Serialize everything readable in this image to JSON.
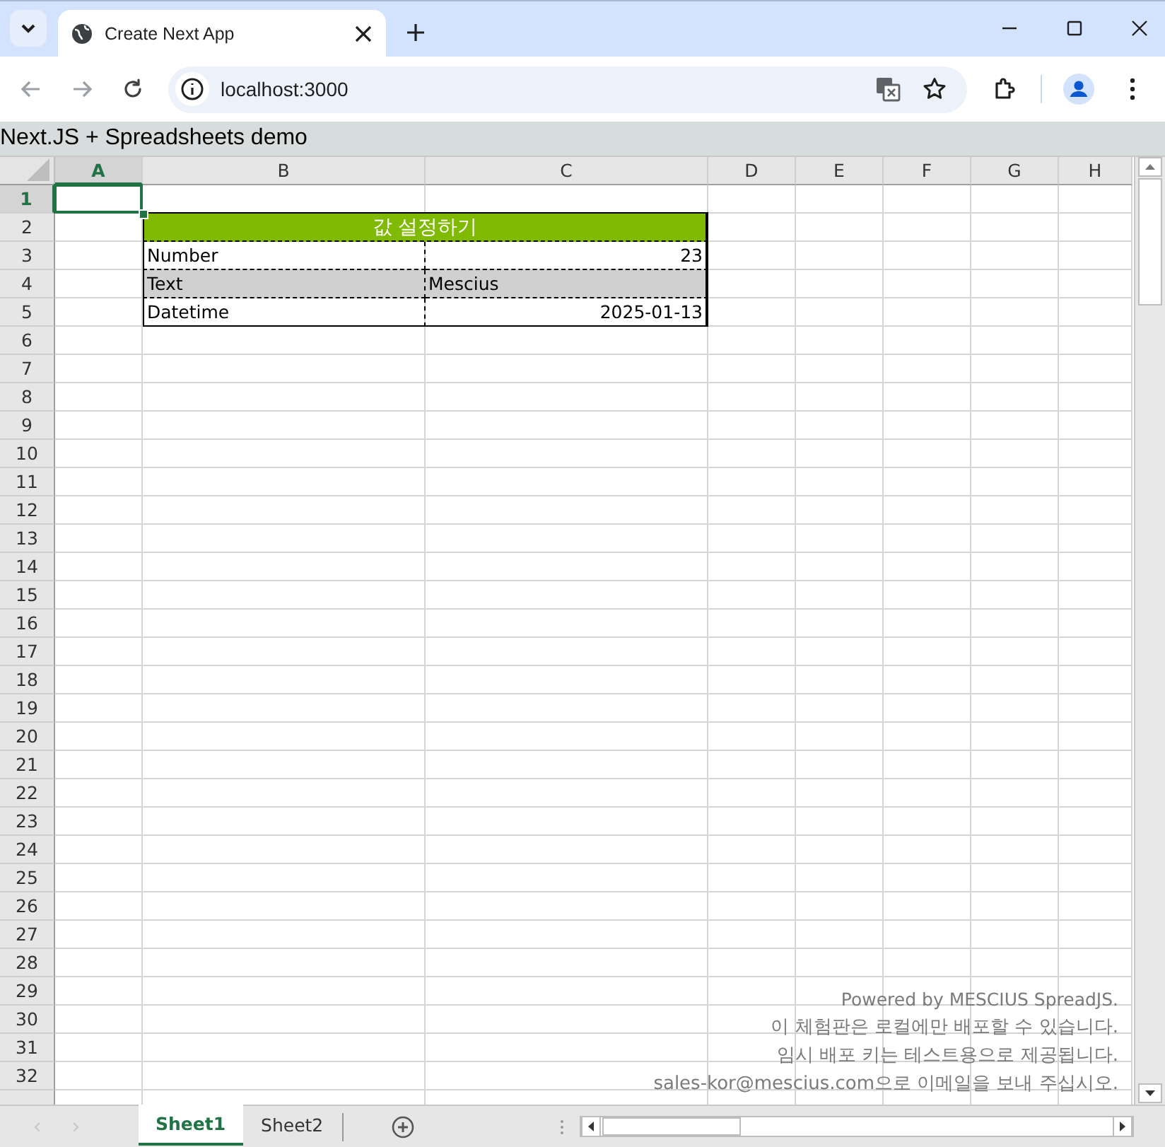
{
  "browser": {
    "tab": {
      "title": "Create Next App",
      "selected": true
    },
    "address": "localhost:3000"
  },
  "page": {
    "heading": "Next.JS + Spreadsheets demo"
  },
  "sheet": {
    "columns": [
      {
        "label": "A",
        "selected": true
      },
      {
        "label": "B",
        "selected": false
      },
      {
        "label": "C",
        "selected": false
      },
      {
        "label": "D",
        "selected": false
      },
      {
        "label": "E",
        "selected": false
      },
      {
        "label": "F",
        "selected": false
      },
      {
        "label": "G",
        "selected": false
      },
      {
        "label": "H",
        "selected": false
      }
    ],
    "rows": [
      {
        "label": "1",
        "selected": true
      },
      {
        "label": "2",
        "selected": false
      },
      {
        "label": "3",
        "selected": false
      },
      {
        "label": "4",
        "selected": false
      },
      {
        "label": "5",
        "selected": false
      },
      {
        "label": "6",
        "selected": false
      },
      {
        "label": "7",
        "selected": false
      },
      {
        "label": "8",
        "selected": false
      },
      {
        "label": "9",
        "selected": false
      },
      {
        "label": "10",
        "selected": false
      },
      {
        "label": "11",
        "selected": false
      },
      {
        "label": "12",
        "selected": false
      },
      {
        "label": "13",
        "selected": false
      },
      {
        "label": "14",
        "selected": false
      },
      {
        "label": "15",
        "selected": false
      },
      {
        "label": "16",
        "selected": false
      },
      {
        "label": "17",
        "selected": false
      },
      {
        "label": "18",
        "selected": false
      },
      {
        "label": "19",
        "selected": false
      },
      {
        "label": "20",
        "selected": false
      },
      {
        "label": "21",
        "selected": false
      },
      {
        "label": "22",
        "selected": false
      },
      {
        "label": "23",
        "selected": false
      },
      {
        "label": "24",
        "selected": false
      },
      {
        "label": "25",
        "selected": false
      },
      {
        "label": "26",
        "selected": false
      },
      {
        "label": "27",
        "selected": false
      },
      {
        "label": "28",
        "selected": false
      },
      {
        "label": "29",
        "selected": false
      },
      {
        "label": "30",
        "selected": false
      },
      {
        "label": "31",
        "selected": false
      },
      {
        "label": "32",
        "selected": false
      }
    ],
    "table": {
      "title": "값 설정하기",
      "rows": [
        {
          "kind": "number",
          "label": "Number",
          "value": "23",
          "shaded": false
        },
        {
          "kind": "text",
          "label": "Text",
          "value": "Mescius",
          "shaded": true
        },
        {
          "kind": "date",
          "label": "Datetime",
          "value": "2025-01-13",
          "shaded": false
        }
      ]
    },
    "notice": [
      "Powered by MESCIUS SpreadJS.",
      "이 체험판은 로컬에만 배포할 수 있습니다.",
      "임시 배포 키는 테스트용으로 제공됩니다.",
      "sales-kor@mescius.com으로 이메일을 보내 주십시오."
    ],
    "tabs": [
      {
        "label": "Sheet1",
        "selected": true
      },
      {
        "label": "Sheet2",
        "selected": false
      }
    ]
  }
}
